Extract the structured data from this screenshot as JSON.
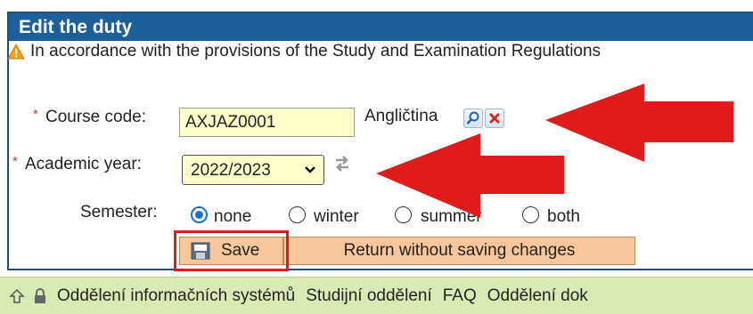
{
  "panel": {
    "title": "Edit the duty",
    "notice": "In accordance with the provisions of the Study and Examination Regulations"
  },
  "form": {
    "course_code_label": "Course code:",
    "course_code_value": "AXJAZ0001",
    "course_name": "Angličtina",
    "academic_year_label": "Academic year:",
    "academic_year_value": "2022/2023",
    "semester_label": "Semester:",
    "semester_options": [
      {
        "label": "none",
        "checked": true
      },
      {
        "label": "winter",
        "checked": false
      },
      {
        "label": "summer",
        "checked": false
      },
      {
        "label": "both",
        "checked": false
      }
    ],
    "required_mark": "*"
  },
  "buttons": {
    "save": "Save",
    "return": "Return without saving changes"
  },
  "footer": {
    "links": [
      "Oddělení informačních systémů",
      "Studijní oddělení",
      "FAQ",
      "Oddělení dok"
    ]
  },
  "colors": {
    "header": "#1d5f99",
    "input_bg": "#ffffcc",
    "button_bg": "#f7c69a",
    "footer_bg": "#d9ebb4",
    "arrow": "#e01b1b"
  },
  "icons": [
    "warning-icon",
    "search-icon",
    "delete-icon",
    "swap-icon",
    "chevron-down-icon",
    "floppy-disk-icon",
    "up-arrow-icon",
    "lock-icon"
  ]
}
